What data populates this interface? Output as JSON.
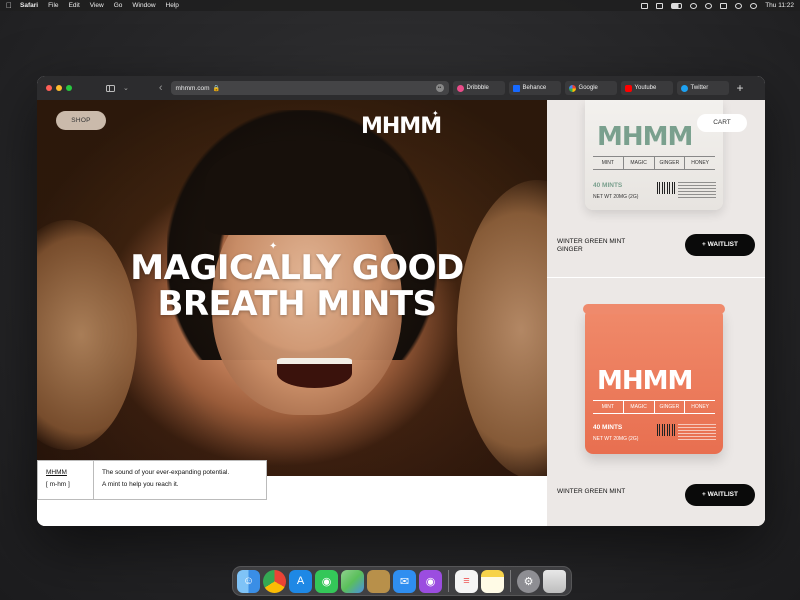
{
  "menubar": {
    "app": "Safari",
    "items": [
      "File",
      "Edit",
      "View",
      "Go",
      "Window",
      "Help"
    ],
    "clock": "Thu 11:22"
  },
  "browser": {
    "url": "mhmm.com",
    "favorites": [
      {
        "label": "Dribbble",
        "icon": "dribbble-icon",
        "color": "#ea4c89"
      },
      {
        "label": "Behance",
        "icon": "behance-icon",
        "color": "#1769ff"
      },
      {
        "label": "Google",
        "icon": "google-icon",
        "color": "#4285f4"
      },
      {
        "label": "Youtube",
        "icon": "youtube-icon",
        "color": "#ff0000"
      },
      {
        "label": "Twitter",
        "icon": "twitter-icon",
        "color": "#1da1f2"
      }
    ]
  },
  "site": {
    "shop_label": "SHOP",
    "logo": "MHMM",
    "cart_label": "CART",
    "headline_line1": "MAGICALLY GOOD",
    "headline_line2": "BREATH MINTS",
    "info": {
      "brand": "MHMM",
      "pronunciation": "[ m-hm ]",
      "tagline_1": "The sound of your ever-expanding potential.",
      "tagline_2": "A mint to help you reach it."
    }
  },
  "products": [
    {
      "name_line1": "WINTER GREEN MINT",
      "name_line2": "GINGER",
      "button": "+ WAITLIST",
      "tin_logo": "MHMM",
      "flavors": [
        "MINT",
        "MAGIC",
        "GINGER",
        "HONEY"
      ],
      "count": "40 MINTS",
      "weight": "NET WT 20MG (2G)",
      "accent": "#7aa08e"
    },
    {
      "name_line1": "WINTER GREEN MINT",
      "button": "+ WAITLIST",
      "tin_logo": "MHMM",
      "flavors": [
        "MINT",
        "MAGIC",
        "GINGER",
        "HONEY"
      ],
      "count": "40 MINTS",
      "weight": "NET WT 20MG (2G)",
      "accent": "#e86f50"
    }
  ],
  "dock": [
    {
      "name": "finder-icon",
      "color": "#3a8ee6"
    },
    {
      "name": "chrome-icon",
      "color": "#e8e8e8"
    },
    {
      "name": "app-store-icon",
      "color": "#1e88e5"
    },
    {
      "name": "messages-icon",
      "color": "#34c759"
    },
    {
      "name": "maps-icon",
      "color": "#5bbf5b"
    },
    {
      "name": "cyberduck-icon",
      "color": "#b8904a"
    },
    {
      "name": "mail-icon",
      "color": "#2f8ef0"
    },
    {
      "name": "podcasts-icon",
      "color": "#9b4de0"
    },
    {
      "name": "reminders-icon",
      "color": "#f5f5f5"
    },
    {
      "name": "notes-icon",
      "color": "#f7d34a"
    },
    {
      "name": "system-settings-icon",
      "color": "#8e8e93"
    },
    {
      "name": "trash-icon",
      "color": "#d0d0d0"
    }
  ]
}
